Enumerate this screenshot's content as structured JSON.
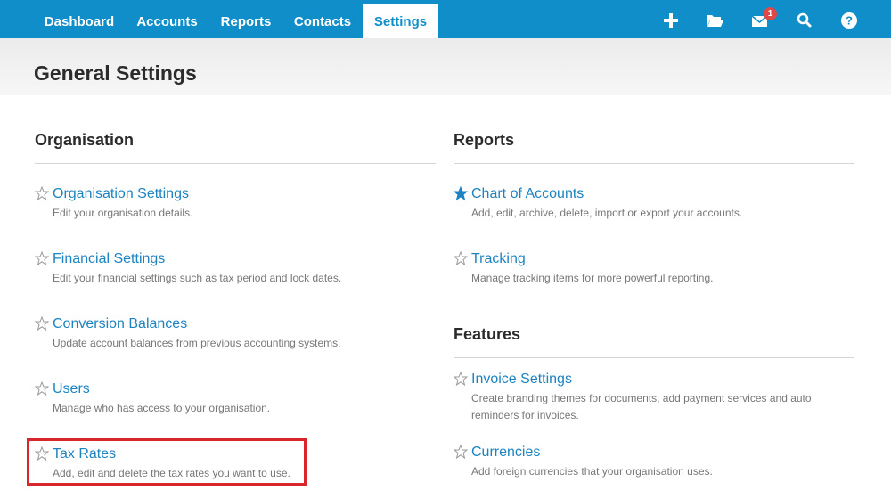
{
  "nav": {
    "tabs": [
      {
        "label": "Dashboard"
      },
      {
        "label": "Accounts"
      },
      {
        "label": "Reports"
      },
      {
        "label": "Contacts"
      },
      {
        "label": "Settings"
      }
    ],
    "active_tab": "Settings",
    "icons": [
      "plus-icon",
      "folder-open-icon",
      "mail-icon",
      "search-icon",
      "help-icon"
    ],
    "mail_badge": "1"
  },
  "page": {
    "title": "General Settings"
  },
  "sections": {
    "organisation": {
      "title": "Organisation",
      "items": [
        {
          "label": "Organisation Settings",
          "description": "Edit your organisation details.",
          "starred": false
        },
        {
          "label": "Financial Settings",
          "description": "Edit your financial settings such as tax period and lock dates.",
          "starred": false
        },
        {
          "label": "Conversion Balances",
          "description": "Update account balances from previous accounting systems.",
          "starred": false
        },
        {
          "label": "Users",
          "description": "Manage who has access to your organisation.",
          "starred": false
        },
        {
          "label": "Tax Rates",
          "description": "Add, edit and delete the tax rates you want to use.",
          "starred": false
        }
      ]
    },
    "reports": {
      "title": "Reports",
      "items": [
        {
          "label": "Chart of Accounts",
          "description": "Add, edit, archive, delete, import or export your accounts.",
          "starred": true
        },
        {
          "label": "Tracking",
          "description": "Manage tracking items for more powerful reporting.",
          "starred": false
        }
      ]
    },
    "features": {
      "title": "Features",
      "items": [
        {
          "label": "Invoice Settings",
          "description_line1": "Create branding themes for documents, add payment services and auto",
          "description_line2": "reminders for invoices.",
          "starred": false
        },
        {
          "label": "Currencies",
          "description": "Add foreign currencies that your organisation uses.",
          "starred": false
        }
      ]
    }
  },
  "colors": {
    "nav_bg": "#0f8ec9",
    "link": "#1d83c1",
    "star_filled": "#1d83c1",
    "highlight_border": "#d8262a"
  }
}
